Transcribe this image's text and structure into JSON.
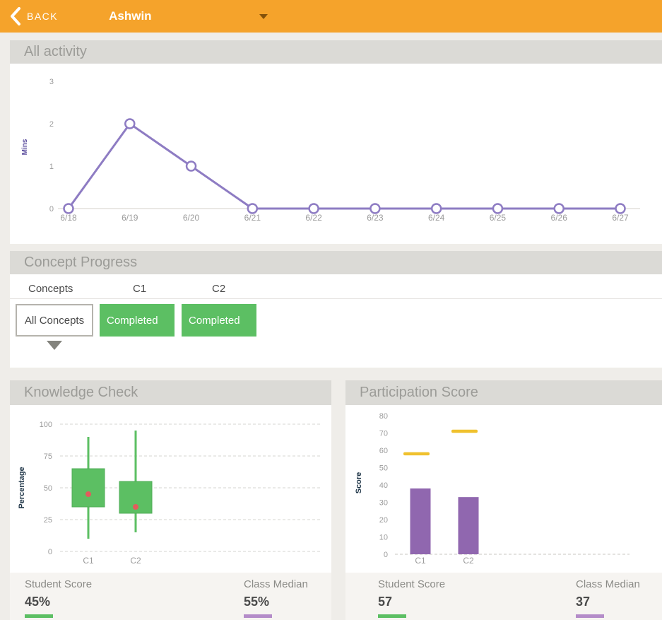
{
  "topbar": {
    "back_label": "BACK",
    "student_name": "Ashwin"
  },
  "sections": {
    "activity": {
      "title": "All activity"
    },
    "concept_progress": {
      "title": "Concept Progress",
      "columns": {
        "c0": "Concepts",
        "c1": "C1",
        "c2": "C2"
      },
      "filter_button": "All Concepts",
      "status_c1": "Completed",
      "status_c2": "Completed"
    },
    "knowledge_check": {
      "title": "Knowledge Check",
      "student_score_label": "Student Score",
      "student_score_value": "45%",
      "class_median_label": "Class Median",
      "class_median_value": "55%"
    },
    "participation": {
      "title": "Participation Score",
      "student_score_label": "Student Score",
      "student_score_value": "57",
      "class_median_label": "Class Median",
      "class_median_value": "37"
    }
  },
  "colors": {
    "topbar_orange": "#F5A32B",
    "line_purple": "#8E7CC3",
    "box_green": "#5CBF63",
    "point_red": "#E25C5C",
    "bar_purple": "#9067AF",
    "marker_yellow": "#F0C12E",
    "tick_gray": "#9B9B9B"
  },
  "chart_data": [
    {
      "type": "line",
      "title": "All activity",
      "x": [
        "6/18",
        "6/19",
        "6/20",
        "6/21",
        "6/22",
        "6/23",
        "6/24",
        "6/25",
        "6/26",
        "6/27"
      ],
      "values": [
        0,
        2,
        1,
        0,
        0,
        0,
        0,
        0,
        0,
        0
      ],
      "ylabel": "Mins",
      "ylim": [
        0,
        3
      ],
      "yticks": [
        0,
        1,
        2,
        3
      ],
      "grid": false,
      "line_color": "#8E7CC3"
    },
    {
      "type": "boxplot",
      "title": "Knowledge Check",
      "categories": [
        "C1",
        "C2"
      ],
      "boxes": [
        {
          "name": "C1",
          "low": 10,
          "q1": 35,
          "q3": 65,
          "high": 90,
          "point": 45
        },
        {
          "name": "C2",
          "low": 15,
          "q1": 30,
          "q3": 55,
          "high": 95,
          "point": 35
        }
      ],
      "ylabel": "Percentage",
      "ylim": [
        0,
        100
      ],
      "yticks": [
        0,
        25,
        50,
        75,
        100
      ],
      "grid": true,
      "box_color": "#5CBF63",
      "point_color": "#E25C5C"
    },
    {
      "type": "bar",
      "title": "Participation Score",
      "categories": [
        "C1",
        "C2"
      ],
      "bars": {
        "name": "Student Score",
        "values": [
          38,
          33
        ],
        "color": "#9067AF"
      },
      "markers": {
        "name": "Class Median",
        "values": [
          58,
          71
        ],
        "color": "#F0C12E"
      },
      "ylabel": "Score",
      "ylim": [
        0,
        80
      ],
      "yticks": [
        0,
        10,
        20,
        30,
        40,
        50,
        60,
        70,
        80
      ],
      "grid": false
    }
  ]
}
